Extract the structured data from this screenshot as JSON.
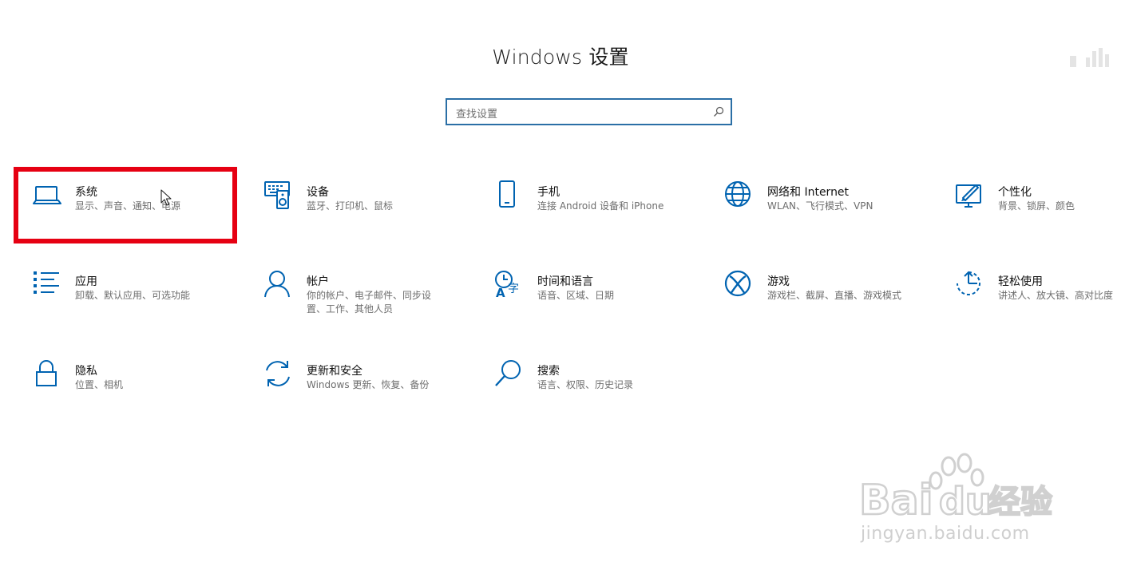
{
  "page": {
    "title": "Windows 设置"
  },
  "search": {
    "placeholder": "查找设置",
    "icon": "search-icon"
  },
  "tiles": [
    {
      "title": "系统",
      "desc": "显示、声音、通知、电源",
      "icon": "laptop-icon"
    },
    {
      "title": "设备",
      "desc": "蓝牙、打印机、鼠标",
      "icon": "devices-icon"
    },
    {
      "title": "手机",
      "desc": "连接 Android 设备和 iPhone",
      "icon": "phone-icon"
    },
    {
      "title": "网络和 Internet",
      "desc": "WLAN、飞行模式、VPN",
      "icon": "globe-icon"
    },
    {
      "title": "个性化",
      "desc": "背景、锁屏、颜色",
      "icon": "paint-icon"
    },
    {
      "title": "应用",
      "desc": "卸载、默认应用、可选功能",
      "icon": "apps-list-icon"
    },
    {
      "title": "帐户",
      "desc": "你的帐户、电子邮件、同步设置、工作、其他人员",
      "icon": "person-icon"
    },
    {
      "title": "时间和语言",
      "desc": "语音、区域、日期",
      "icon": "time-language-icon"
    },
    {
      "title": "游戏",
      "desc": "游戏栏、截屏、直播、游戏模式",
      "icon": "xbox-icon"
    },
    {
      "title": "轻松使用",
      "desc": "讲述人、放大镜、高对比度",
      "icon": "ease-of-access-icon"
    },
    {
      "title": "隐私",
      "desc": "位置、相机",
      "icon": "lock-icon"
    },
    {
      "title": "更新和安全",
      "desc": "Windows 更新、恢复、备份",
      "icon": "update-icon"
    },
    {
      "title": "搜索",
      "desc": "语言、权限、历史记录",
      "icon": "search-magnifier-icon"
    }
  ],
  "watermark": {
    "brand": "Bai du 经验",
    "url": "jingyan.baidu.com"
  },
  "colors": {
    "accent": "#0063b1",
    "highlight": "#e60012",
    "search_border": "#2b6fa6"
  }
}
